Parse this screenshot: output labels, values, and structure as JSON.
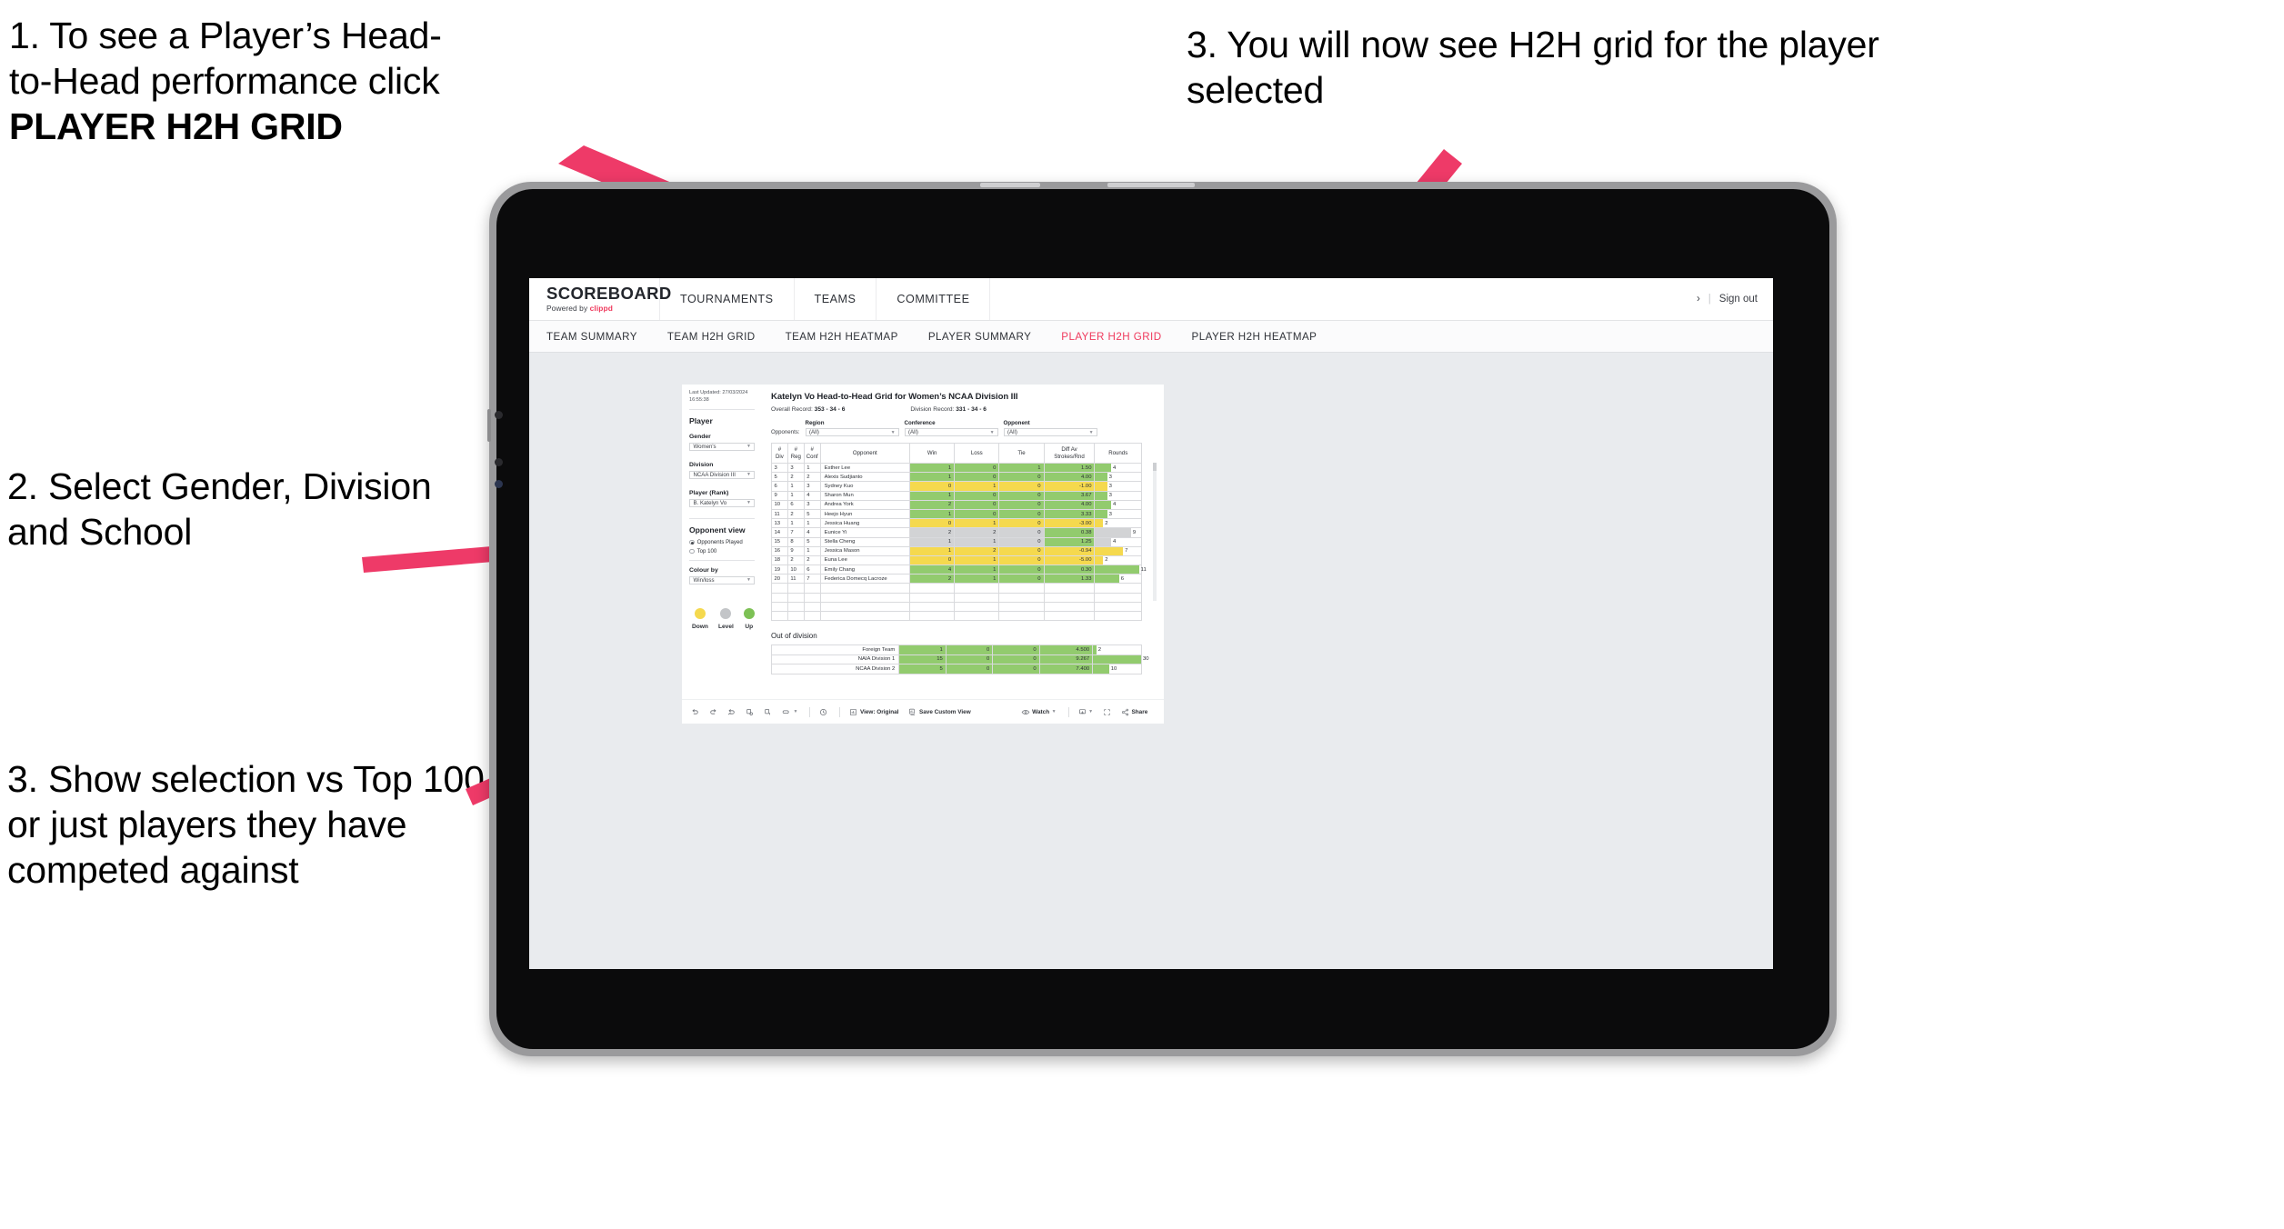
{
  "annotations": [
    {
      "id": "a1",
      "line1": "1. To see a Player’s Head-",
      "line2": "to-Head performance click",
      "line3": "PLAYER H2H GRID"
    },
    {
      "id": "a2",
      "text": "2. Select Gender, Division and School"
    },
    {
      "id": "a3",
      "text": "3. Show selection vs Top 100 or just players they have competed against"
    },
    {
      "id": "a4",
      "text": "3. You will now see H2H grid for the player selected"
    }
  ],
  "brand": {
    "name": "SCOREBOARD",
    "powered_prefix": "Powered by ",
    "powered_brand": "clippd"
  },
  "topnav": {
    "items": [
      "TOURNAMENTS",
      "TEAMS",
      "COMMITTEE"
    ],
    "user_chevron": "›",
    "separator": "|",
    "signout": "Sign out"
  },
  "subnav": {
    "items": [
      {
        "label": "TEAM SUMMARY",
        "active": false
      },
      {
        "label": "TEAM H2H GRID",
        "active": false
      },
      {
        "label": "TEAM H2H HEATMAP",
        "active": false
      },
      {
        "label": "PLAYER SUMMARY",
        "active": false
      },
      {
        "label": "PLAYER H2H GRID",
        "active": true
      },
      {
        "label": "PLAYER H2H HEATMAP",
        "active": false
      }
    ]
  },
  "panel": {
    "last_updated": "Last Updated: 27/03/2024 16:55:38",
    "player_heading": "Player",
    "gender_label": "Gender",
    "gender_value": "Women's",
    "division_label": "Division",
    "division_value": "NCAA Division III",
    "player_rank_label": "Player (Rank)",
    "player_rank_value": "B. Katelyn Vo",
    "opponent_view_heading": "Opponent view",
    "radio_opponents_played": "Opponents Played",
    "radio_top100": "Top 100",
    "colour_by_label": "Colour by",
    "colour_by_value": "Win/loss",
    "legend": [
      {
        "label": "Down",
        "color": "#f5d94e"
      },
      {
        "label": "Level",
        "color": "#c3c5c8"
      },
      {
        "label": "Up",
        "color": "#7dc155"
      }
    ]
  },
  "main": {
    "title": "Katelyn Vo Head-to-Head Grid for Women’s NCAA Division III",
    "overall_label": "Overall Record:",
    "overall_value": "353 -  34 - 6",
    "division_label": "Division Record:",
    "division_value": "331 -  34 - 6",
    "opponents_label": "Opponents:",
    "filters": [
      {
        "label": "Region",
        "value": "(All)"
      },
      {
        "label": "Conference",
        "value": "(All)"
      },
      {
        "label": "Opponent",
        "value": "(All)"
      }
    ],
    "columns": [
      "#\nDiv",
      "#\nReg",
      "#\nConf",
      "Opponent",
      "Win",
      "Loss",
      "Tie",
      "Diff Av\nStrokes/Rnd",
      "Rounds"
    ],
    "column_labels": {
      "div_l1": "#",
      "div_l2": "Div",
      "reg_l1": "#",
      "reg_l2": "Reg",
      "conf_l1": "#",
      "conf_l2": "Conf",
      "opponent": "Opponent",
      "win": "Win",
      "loss": "Loss",
      "tie": "Tie",
      "diff_l1": "Diff Av",
      "diff_l2": "Strokes/Rnd",
      "rounds": "Rounds"
    },
    "rows": [
      {
        "div": "3",
        "reg": "3",
        "conf": "1",
        "opponent": "Esther Lee",
        "win": "1",
        "loss": "0",
        "tie": "1",
        "diff": "1.50",
        "rounds": "4",
        "state": "g"
      },
      {
        "div": "5",
        "reg": "2",
        "conf": "2",
        "opponent": "Alexis Sudjianto",
        "win": "1",
        "loss": "0",
        "tie": "0",
        "diff": "4.00",
        "rounds": "3",
        "state": "g"
      },
      {
        "div": "6",
        "reg": "1",
        "conf": "3",
        "opponent": "Sydney Kuo",
        "win": "0",
        "loss": "1",
        "tie": "0",
        "diff": "-1.00",
        "rounds": "3",
        "state": "y"
      },
      {
        "div": "9",
        "reg": "1",
        "conf": "4",
        "opponent": "Sharon Mun",
        "win": "1",
        "loss": "0",
        "tie": "0",
        "diff": "3.67",
        "rounds": "3",
        "state": "g"
      },
      {
        "div": "10",
        "reg": "6",
        "conf": "3",
        "opponent": "Andrea York",
        "win": "2",
        "loss": "0",
        "tie": "0",
        "diff": "4.00",
        "rounds": "4",
        "state": "g"
      },
      {
        "div": "11",
        "reg": "2",
        "conf": "5",
        "opponent": "Heejo Hyun",
        "win": "1",
        "loss": "0",
        "tie": "0",
        "diff": "3.33",
        "rounds": "3",
        "state": "g"
      },
      {
        "div": "13",
        "reg": "1",
        "conf": "1",
        "opponent": "Jessica Huang",
        "win": "0",
        "loss": "1",
        "tie": "0",
        "diff": "-3.00",
        "rounds": "2",
        "state": "y"
      },
      {
        "div": "14",
        "reg": "7",
        "conf": "4",
        "opponent": "Eunice Yi",
        "win": "2",
        "loss": "2",
        "tie": "0",
        "diff": "0.38",
        "rounds": "9",
        "state": "n"
      },
      {
        "div": "15",
        "reg": "8",
        "conf": "5",
        "opponent": "Stella Cheng",
        "win": "1",
        "loss": "1",
        "tie": "0",
        "diff": "1.25",
        "rounds": "4",
        "state": "n"
      },
      {
        "div": "16",
        "reg": "9",
        "conf": "1",
        "opponent": "Jessica Mason",
        "win": "1",
        "loss": "2",
        "tie": "0",
        "diff": "-0.94",
        "rounds": "7",
        "state": "y"
      },
      {
        "div": "18",
        "reg": "2",
        "conf": "2",
        "opponent": "Euna Lee",
        "win": "0",
        "loss": "1",
        "tie": "0",
        "diff": "-5.00",
        "rounds": "2",
        "state": "y"
      },
      {
        "div": "19",
        "reg": "10",
        "conf": "6",
        "opponent": "Emily Chang",
        "win": "4",
        "loss": "1",
        "tie": "0",
        "diff": "0.30",
        "rounds": "11",
        "state": "g"
      },
      {
        "div": "20",
        "reg": "11",
        "conf": "7",
        "opponent": "Federica Domecq Lacroze",
        "win": "2",
        "loss": "1",
        "tie": "0",
        "diff": "1.33",
        "rounds": "6",
        "state": "g"
      }
    ],
    "out_of_division_title": "Out of division",
    "out_of_division_rows": [
      {
        "name": "Foreign Team",
        "win": "1",
        "loss": "0",
        "tie": "0",
        "diff": "4.500",
        "rounds": "2",
        "state": "g"
      },
      {
        "name": "NAIA Division 1",
        "win": "15",
        "loss": "0",
        "tie": "0",
        "diff": "9.267",
        "rounds": "30",
        "state": "g"
      },
      {
        "name": "NCAA Division 2",
        "win": "5",
        "loss": "0",
        "tie": "0",
        "diff": "7.400",
        "rounds": "10",
        "state": "g"
      }
    ]
  },
  "toolbar": {
    "view_label": "View: Original",
    "save_label": "Save Custom View",
    "watch_label": "Watch",
    "share_label": "Share"
  },
  "colors": {
    "accent": "#ef3a5d",
    "arrow": "#ee3a68",
    "up": "#92cb6e",
    "down": "#f5d94e",
    "level": "#d2d3d5",
    "canvas": "#e9ebee"
  },
  "chart_data": {
    "type": "table",
    "title": "Katelyn Vo Head-to-Head Grid for Women’s NCAA Division III",
    "columns": [
      "# Div",
      "# Reg",
      "# Conf",
      "Opponent",
      "Win",
      "Loss",
      "Tie",
      "Diff Av Strokes/Rnd",
      "Rounds"
    ],
    "rows": [
      [
        "3",
        "3",
        "1",
        "Esther Lee",
        1,
        0,
        1,
        1.5,
        4
      ],
      [
        "5",
        "2",
        "2",
        "Alexis Sudjianto",
        1,
        0,
        0,
        4.0,
        3
      ],
      [
        "6",
        "1",
        "3",
        "Sydney Kuo",
        0,
        1,
        0,
        -1.0,
        3
      ],
      [
        "9",
        "1",
        "4",
        "Sharon Mun",
        1,
        0,
        0,
        3.67,
        3
      ],
      [
        "10",
        "6",
        "3",
        "Andrea York",
        2,
        0,
        0,
        4.0,
        4
      ],
      [
        "11",
        "2",
        "5",
        "Heejo Hyun",
        1,
        0,
        0,
        3.33,
        3
      ],
      [
        "13",
        "1",
        "1",
        "Jessica Huang",
        0,
        1,
        0,
        -3.0,
        2
      ],
      [
        "14",
        "7",
        "4",
        "Eunice Yi",
        2,
        2,
        0,
        0.38,
        9
      ],
      [
        "15",
        "8",
        "5",
        "Stella Cheng",
        1,
        1,
        0,
        1.25,
        4
      ],
      [
        "16",
        "9",
        "1",
        "Jessica Mason",
        1,
        2,
        0,
        -0.94,
        7
      ],
      [
        "18",
        "2",
        "2",
        "Euna Lee",
        0,
        1,
        0,
        -5.0,
        2
      ],
      [
        "19",
        "10",
        "6",
        "Emily Chang",
        4,
        1,
        0,
        0.3,
        11
      ],
      [
        "20",
        "11",
        "7",
        "Federica Domecq Lacroze",
        2,
        1,
        0,
        1.33,
        6
      ]
    ],
    "out_of_division": [
      [
        "Foreign Team",
        1,
        0,
        0,
        4.5,
        2
      ],
      [
        "NAIA Division 1",
        15,
        0,
        0,
        9.267,
        30
      ],
      [
        "NCAA Division 2",
        5,
        0,
        0,
        7.4,
        10
      ]
    ],
    "rounds_bar_max": 30,
    "legend": [
      "Down",
      "Level",
      "Up"
    ]
  }
}
